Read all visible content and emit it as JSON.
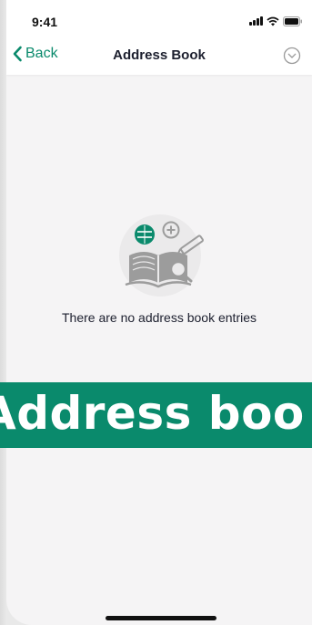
{
  "status_bar": {
    "time": "9:41"
  },
  "nav": {
    "back_label": "Back",
    "title": "Address Book"
  },
  "empty_state": {
    "message": "There are no address book entries"
  },
  "banner": {
    "text": "Address boo"
  },
  "colors": {
    "accent": "#0a8a6c",
    "title_text": "#1c1f2e",
    "background": "#f5f4f5"
  },
  "icons": [
    "chevron-left-icon",
    "options-circle-icon",
    "address-book-illustration-icon",
    "signal-icon",
    "wifi-icon",
    "battery-icon"
  ]
}
